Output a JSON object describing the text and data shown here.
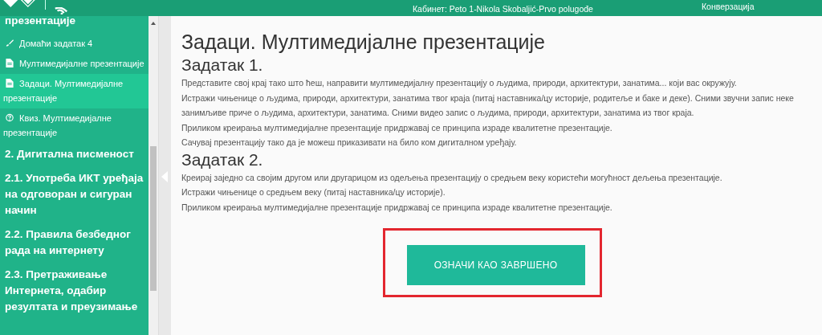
{
  "header": {
    "cabinet": "Кабинет: Peto 1-Nikola Skobaljić-Prvo polugođe",
    "link": "Конверзација"
  },
  "sidebar": {
    "items": [
      {
        "kind": "section",
        "label": "презентације",
        "selected": false
      },
      {
        "kind": "homework",
        "label": "Домаћи задатак 4",
        "selected": false
      },
      {
        "kind": "page",
        "label": "Мултимедијалне презентације",
        "selected": false
      },
      {
        "kind": "page",
        "label": "Задаци. Мултимедијалне презентације",
        "selected": true
      },
      {
        "kind": "quiz",
        "label": "Квиз. Мултимедијалне презентације",
        "selected": false
      },
      {
        "kind": "section",
        "label": "2. Дигитална писменост",
        "selected": false
      },
      {
        "kind": "section",
        "label": "2.1. Употреба ИКТ уређаја на одговоран и сигуран начин",
        "selected": false
      },
      {
        "kind": "section",
        "label": "2.2. Правила безбедног рада на интернету",
        "selected": false
      },
      {
        "kind": "section",
        "label": "2.3. Претраживање Интернета, одабир резултата и преузимање",
        "selected": false
      }
    ]
  },
  "content": {
    "title": "Задаци. Мултимедијалне презентације",
    "tasks": [
      {
        "heading": "Задатак 1.",
        "paragraphs": [
          "Представите свој крај тако што ћеш, направити мултимедијалну презентацију о људима, природи, архитектури, занатима... који вас окружују.",
          "Истражи чињенице о људима, природи, архитектури, занатима твог краја (питај наставника/цу историје, родитеље и баке и деке). Сними звучни запис неке занимљиве приче о људима, архитектури, занатима. Сними видео запис о људима, природи, архитектури, занатима из твог краја.",
          "Приликом креирања мултимедијалне презентације придржавај се принципа израде квалитетне презентације.",
          "Сачувај презентацију тако да је можеш приказивати на било ком дигиталном уређају."
        ]
      },
      {
        "heading": "Задатак 2.",
        "paragraphs": [
          "Креирај заједно са својим другом или другарицом из одељења презентацију о средњем веку користећи могућност дељења презентације.",
          "Истражи чињенице о средњем веку (питај наставника/цу историје).",
          "Приликом креирања мултимедијалне презентације придржавај се принципа израде квалитетне презентације."
        ]
      }
    ],
    "button": {
      "label": "ОЗНАЧИ КАО ЗАВРШЕНО",
      "highlighted": true
    }
  }
}
